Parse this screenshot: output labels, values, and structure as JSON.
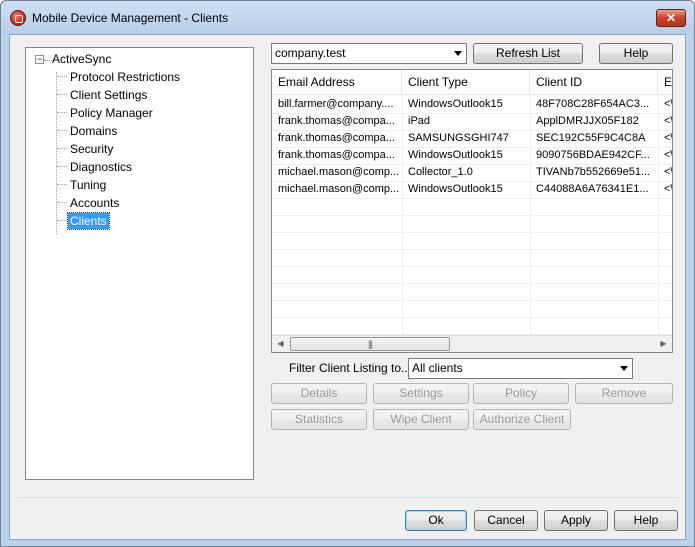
{
  "window": {
    "title": "Mobile Device Management - Clients",
    "close_label": "✕"
  },
  "tree": {
    "root": {
      "label": "ActiveSync",
      "expander": "−"
    },
    "items": [
      {
        "label": "Protocol Restrictions"
      },
      {
        "label": "Client Settings"
      },
      {
        "label": "Policy Manager"
      },
      {
        "label": "Domains"
      },
      {
        "label": "Security"
      },
      {
        "label": "Diagnostics"
      },
      {
        "label": "Tuning"
      },
      {
        "label": "Accounts"
      },
      {
        "label": "Clients",
        "selected": true
      }
    ]
  },
  "toolbar": {
    "domain_value": "company.test",
    "refresh_label": "Refresh List",
    "help_label": "Help"
  },
  "table": {
    "columns": [
      "Email Address",
      "Client Type",
      "Client ID",
      "Ef"
    ],
    "rows": [
      [
        "bill.farmer@company....",
        "WindowsOutlook15",
        "48F708C28F654AC3...",
        "<\\"
      ],
      [
        "frank.thomas@compa...",
        "iPad",
        "ApplDMRJJX05F182",
        "<\\"
      ],
      [
        "frank.thomas@compa...",
        "SAMSUNGSGHI747",
        "SEC192C55F9C4C8A",
        "<\\"
      ],
      [
        "frank.thomas@compa...",
        "WindowsOutlook15",
        "9090756BDAE942CF...",
        "<\\"
      ],
      [
        "michael.mason@comp...",
        "Collector_1.0",
        "TIVANb7b552669e51...",
        "<\\"
      ],
      [
        "michael.mason@comp...",
        "WindowsOutlook15",
        "C44088A6A76341E1...",
        "<\\"
      ]
    ],
    "scroll_left": "◀",
    "scroll_right": "▶",
    "thumb_grip": "|||"
  },
  "filter": {
    "label": "Filter Client Listing to...",
    "value": "All clients"
  },
  "actions": {
    "details": "Details",
    "settings": "Settings",
    "policy": "Policy",
    "remove": "Remove",
    "statistics": "Statistics",
    "wipe": "Wipe Client",
    "authorize": "Authorize Client"
  },
  "footer": {
    "ok": "Ok",
    "cancel": "Cancel",
    "apply": "Apply",
    "help": "Help"
  }
}
